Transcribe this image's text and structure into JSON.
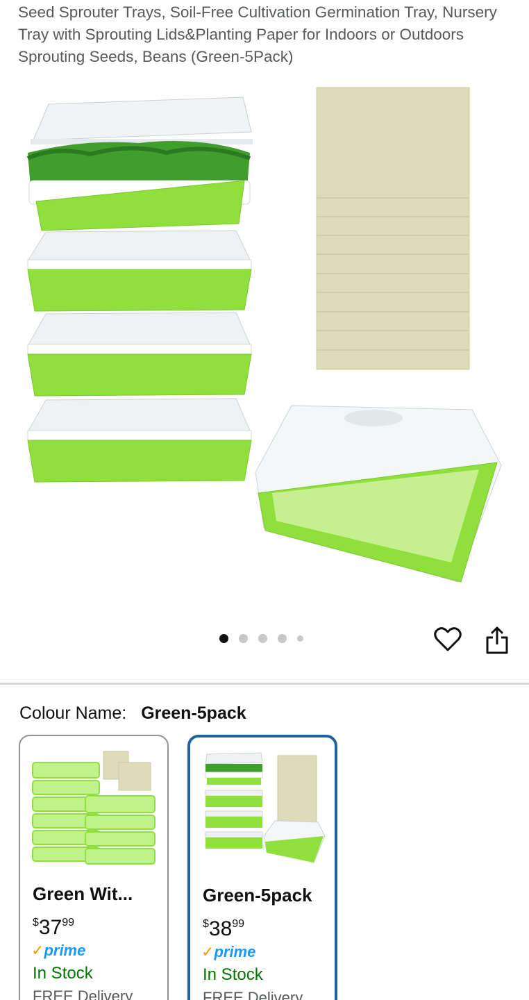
{
  "product": {
    "title": "Seed Sprouter Trays, Soil-Free Cultivation Germination Tray, Nursery Tray with Sprouting Lids&Planting Paper for Indoors or Outdoors Sprouting Seeds, Beans (Green-5Pack)"
  },
  "gallery": {
    "image_count": 5,
    "active_index": 0
  },
  "actions": {
    "wishlist_icon": "heart-outline-icon",
    "share_icon": "share-icon"
  },
  "colour": {
    "label": "Colour Name:",
    "selected": "Green-5pack"
  },
  "variants": [
    {
      "name": "Green Wit...",
      "price_currency": "$",
      "price_whole": "37",
      "price_fraction": "99",
      "prime": "prime",
      "stock": "In Stock",
      "delivery": "FREE Delivery"
    },
    {
      "name": "Green-5pack",
      "price_currency": "$",
      "price_whole": "38",
      "price_fraction": "99",
      "prime": "prime",
      "stock": "In Stock",
      "delivery": "FREE Delivery"
    }
  ],
  "colors": {
    "tray_green": "#8fe03c",
    "selected_border": "#2162a1",
    "in_stock": "#007600",
    "prime_blue": "#1a98ff",
    "prime_check": "#ff9900"
  }
}
